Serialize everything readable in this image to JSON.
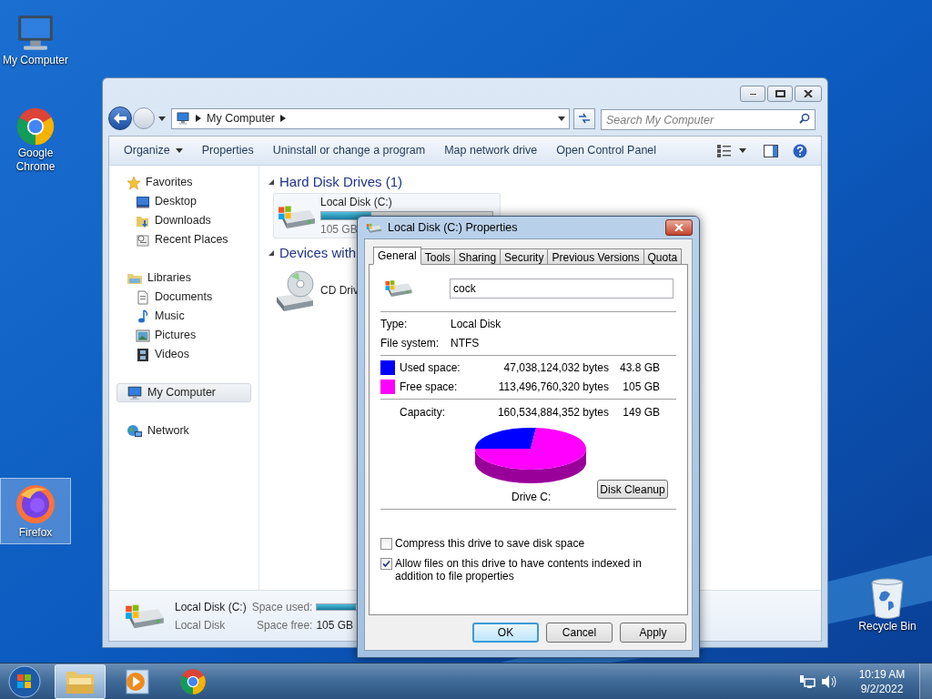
{
  "desktop_icons": [
    {
      "label": "My Computer",
      "kind": "computer",
      "selected": false
    },
    {
      "label": "Google Chrome",
      "kind": "chrome",
      "selected": false
    },
    {
      "label": "Firefox",
      "kind": "firefox",
      "selected": true
    },
    {
      "label": "Recycle Bin",
      "kind": "recycle",
      "selected": false
    }
  ],
  "explorer": {
    "address": [
      "My Computer"
    ],
    "search": {
      "placeholder": "Search My Computer"
    },
    "commands": [
      {
        "label": "Organize",
        "kind": "menu"
      },
      {
        "label": "Properties",
        "kind": "action"
      },
      {
        "label": "Uninstall or change a program",
        "kind": "action"
      },
      {
        "label": "Map network drive",
        "kind": "action"
      },
      {
        "label": "Open Control Panel",
        "kind": "action"
      }
    ],
    "sidebar": [
      {
        "label": "Favorites",
        "kind": "favorites",
        "selected": false,
        "children": [
          {
            "label": "Desktop",
            "kind": "desktop",
            "selected": false
          },
          {
            "label": "Downloads",
            "kind": "downloads",
            "selected": false
          },
          {
            "label": "Recent Places",
            "kind": "recent",
            "selected": false
          }
        ]
      },
      {
        "label": "Libraries",
        "kind": "libraries",
        "selected": false,
        "children": [
          {
            "label": "Documents",
            "kind": "documents",
            "selected": false
          },
          {
            "label": "Music",
            "kind": "music",
            "selected": false
          },
          {
            "label": "Pictures",
            "kind": "pictures",
            "selected": false
          },
          {
            "label": "Videos",
            "kind": "videos",
            "selected": false
          }
        ]
      },
      {
        "label": "My Computer",
        "kind": "computer",
        "selected": true
      },
      {
        "label": "Network",
        "kind": "network",
        "selected": false
      }
    ],
    "groups": [
      {
        "label": "Hard Disk Drives (1)",
        "items": [
          {
            "kind": "disk",
            "name": "Local Disk (C:)",
            "detail": "105 GB",
            "level": 0.29
          }
        ]
      },
      {
        "label": "Devices with",
        "items": [
          {
            "kind": "cd",
            "name": "CD Driv"
          }
        ]
      }
    ],
    "details": {
      "name": "Local Disk (C:)",
      "type": "Local Disk",
      "used_label": "Space used:",
      "level": 0.29,
      "free_label": "Space free:",
      "free": "105 GB"
    }
  },
  "dialog": {
    "title": "Local Disk (C:) Properties",
    "tabs": [
      {
        "label": "General",
        "selected": true
      },
      {
        "label": "Tools",
        "selected": false
      },
      {
        "label": "Sharing",
        "selected": false
      },
      {
        "label": "Security",
        "selected": false
      },
      {
        "label": "Previous Versions",
        "selected": false
      },
      {
        "label": "Quota",
        "selected": false
      }
    ],
    "volume_label": "cock ",
    "properties": [
      {
        "label": "Type:",
        "value": "Local Disk"
      },
      {
        "label": "File system:",
        "value": "NTFS"
      }
    ],
    "usage": [
      {
        "label": "Used space:",
        "bytes": "47,038,124,032 bytes",
        "size": "43.8 GB",
        "color": "#0000ff"
      },
      {
        "label": "Free space:",
        "bytes": "113,496,760,320 bytes",
        "size": "105 GB",
        "color": "#ff00ff"
      }
    ],
    "capacity": {
      "label": "Capacity:",
      "bytes": "160,534,884,352 bytes",
      "size": "149 GB"
    },
    "drive_label": "Drive C:",
    "cleanup_button": "Disk Cleanup",
    "options": [
      {
        "label": "Compress this drive to save disk space",
        "checked": false
      },
      {
        "label": "Allow files on this drive to have contents indexed in addition to file properties",
        "checked": true
      }
    ],
    "buttons": [
      {
        "label": "OK",
        "default": true
      },
      {
        "label": "Cancel",
        "default": false
      },
      {
        "label": "Apply",
        "default": false
      }
    ]
  },
  "taskbar": {
    "apps": [
      {
        "kind": "explorer",
        "selected": true
      },
      {
        "kind": "media",
        "selected": false
      },
      {
        "kind": "chrome",
        "selected": false
      }
    ],
    "clock": {
      "time": "10:19 AM",
      "date": "9/2/2022"
    }
  }
}
